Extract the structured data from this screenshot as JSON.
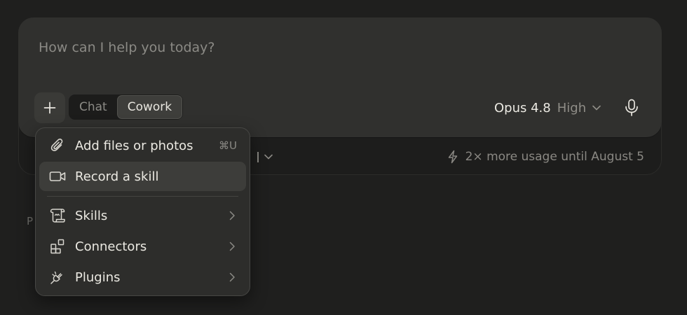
{
  "composer": {
    "placeholder": "How can I help you today?",
    "modes": [
      {
        "label": "Chat",
        "active": false
      },
      {
        "label": "Cowork",
        "active": true
      }
    ],
    "model": {
      "name": "Opus 4.8",
      "effort": "High"
    },
    "usage_note": "2× more usage until August 5"
  },
  "menu": {
    "items": [
      {
        "label": "Add files or photos",
        "shortcut": "⌘U",
        "icon": "paperclip-icon"
      },
      {
        "label": "Record a skill",
        "icon": "video-camera-icon",
        "highlighted": true
      },
      {
        "label": "Skills",
        "icon": "scroll-icon",
        "submenu": true
      },
      {
        "label": "Connectors",
        "icon": "connectors-grid-icon",
        "submenu": true
      },
      {
        "label": "Plugins",
        "icon": "plug-icon",
        "submenu": true
      }
    ]
  },
  "colors": {
    "background": "#1f1f1e",
    "card": "#30302e",
    "menu": "#2d2d2b",
    "text": "#ebe9e2",
    "muted": "#8b8a85"
  }
}
